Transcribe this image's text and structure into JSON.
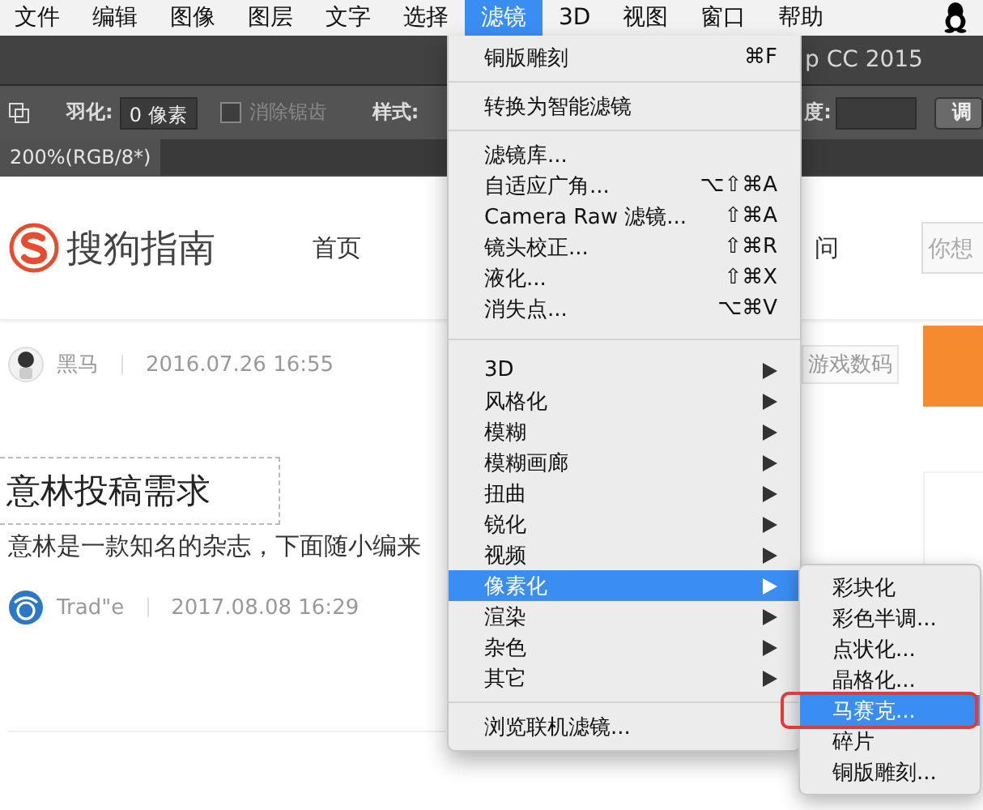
{
  "menu_bar": {
    "items": [
      {
        "label": "文件",
        "selected": false
      },
      {
        "label": "编辑",
        "selected": false
      },
      {
        "label": "图像",
        "selected": false
      },
      {
        "label": "图层",
        "selected": false
      },
      {
        "label": "文字",
        "selected": false
      },
      {
        "label": "选择",
        "selected": false
      },
      {
        "label": "滤镜",
        "selected": true
      },
      {
        "label": "3D",
        "selected": false
      },
      {
        "label": "视图",
        "selected": false
      },
      {
        "label": "窗口",
        "selected": false
      },
      {
        "label": "帮助",
        "selected": false
      }
    ]
  },
  "app": {
    "title": "p CC 2015",
    "options": {
      "feather_label": "羽化:",
      "feather_value": "0 像素",
      "antialias": {
        "label": "消除锯齿",
        "checked": false,
        "disabled": true
      },
      "style_label": "样式:",
      "height_label": "度:",
      "adjust_button": "调"
    },
    "document_tab": "200%(RGB/8*)"
  },
  "page": {
    "logo": "搜狗指南",
    "nav": [
      "首页",
      "问"
    ],
    "search": {
      "placeholder": "你想"
    },
    "post": {
      "author": "黑马",
      "date": "2016.07.26 16:55",
      "tag": "游戏数码"
    },
    "article": {
      "title": "意林投稿需求",
      "summary": "意林是一款知名的杂志，下面随小编来",
      "author": "Trad\"e",
      "date": "2017.08.08 16:29"
    }
  },
  "filter_menu": {
    "items": [
      {
        "kind": "item",
        "label": "铜版雕刻",
        "shortcut": "⌘F"
      },
      {
        "kind": "separator"
      },
      {
        "kind": "item",
        "label": "转换为智能滤镜"
      },
      {
        "kind": "separator"
      },
      {
        "kind": "item",
        "label": "滤镜库..."
      },
      {
        "kind": "item",
        "label": "自适应广角...",
        "shortcut": "⌥⇧⌘A"
      },
      {
        "kind": "item",
        "label": "Camera Raw 滤镜...",
        "shortcut": "⇧⌘A"
      },
      {
        "kind": "item",
        "label": "镜头校正...",
        "shortcut": "⇧⌘R"
      },
      {
        "kind": "item",
        "label": "液化...",
        "shortcut": "⇧⌘X"
      },
      {
        "kind": "item",
        "label": "消失点...",
        "shortcut": "⌥⌘V"
      },
      {
        "kind": "separator"
      },
      {
        "kind": "submenu",
        "label": "3D",
        "selected": false
      },
      {
        "kind": "submenu",
        "label": "风格化",
        "selected": false
      },
      {
        "kind": "submenu",
        "label": "模糊",
        "selected": false
      },
      {
        "kind": "submenu",
        "label": "模糊画廊",
        "selected": false
      },
      {
        "kind": "submenu",
        "label": "扭曲",
        "selected": false
      },
      {
        "kind": "submenu",
        "label": "锐化",
        "selected": false
      },
      {
        "kind": "submenu",
        "label": "视频",
        "selected": false
      },
      {
        "kind": "submenu",
        "label": "像素化",
        "selected": true
      },
      {
        "kind": "submenu",
        "label": "渲染",
        "selected": false
      },
      {
        "kind": "submenu",
        "label": "杂色",
        "selected": false
      },
      {
        "kind": "submenu",
        "label": "其它",
        "selected": false
      },
      {
        "kind": "separator"
      },
      {
        "kind": "item",
        "label": "浏览联机滤镜..."
      }
    ]
  },
  "submenu": {
    "items": [
      {
        "label": "彩块化",
        "selected": false,
        "annotated": false
      },
      {
        "label": "彩色半调...",
        "selected": false,
        "annotated": false
      },
      {
        "label": "点状化...",
        "selected": false,
        "annotated": false
      },
      {
        "label": "晶格化...",
        "selected": false,
        "annotated": false
      },
      {
        "label": "马赛克...",
        "selected": true,
        "annotated": true
      },
      {
        "label": "碎片",
        "selected": false,
        "annotated": false
      },
      {
        "label": "铜版雕刻...",
        "selected": false,
        "annotated": false
      }
    ]
  }
}
